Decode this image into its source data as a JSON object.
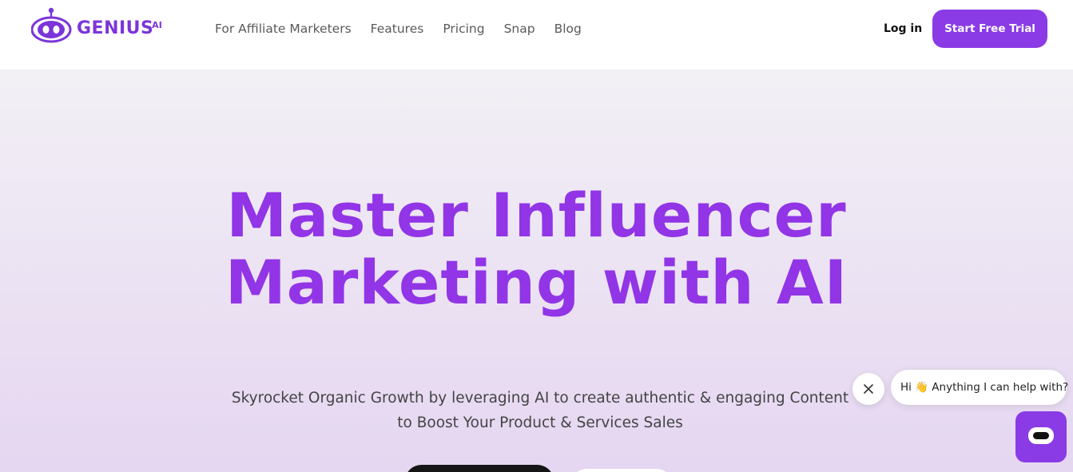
{
  "header": {
    "logo_text": "GENIUS",
    "logo_suffix": ".AI",
    "nav": [
      "For Affiliate Marketers",
      "Features",
      "Pricing",
      "Snap",
      "Blog"
    ],
    "login_label": "Log in",
    "trial_label": "Start Free Trial"
  },
  "hero": {
    "headline_line1": "Master Influencer",
    "headline_line2": "Marketing with AI",
    "subtitle_line1": "Skyrocket Organic Growth by leveraging AI to create authentic & engaging Content",
    "subtitle_line2": "to Boost Your Product & Services Sales"
  },
  "chat": {
    "greeting": "Hi 👋 Anything I can help with?"
  },
  "colors": {
    "brand_purple": "#8a3be6",
    "headline_purple": "#9135e6"
  }
}
